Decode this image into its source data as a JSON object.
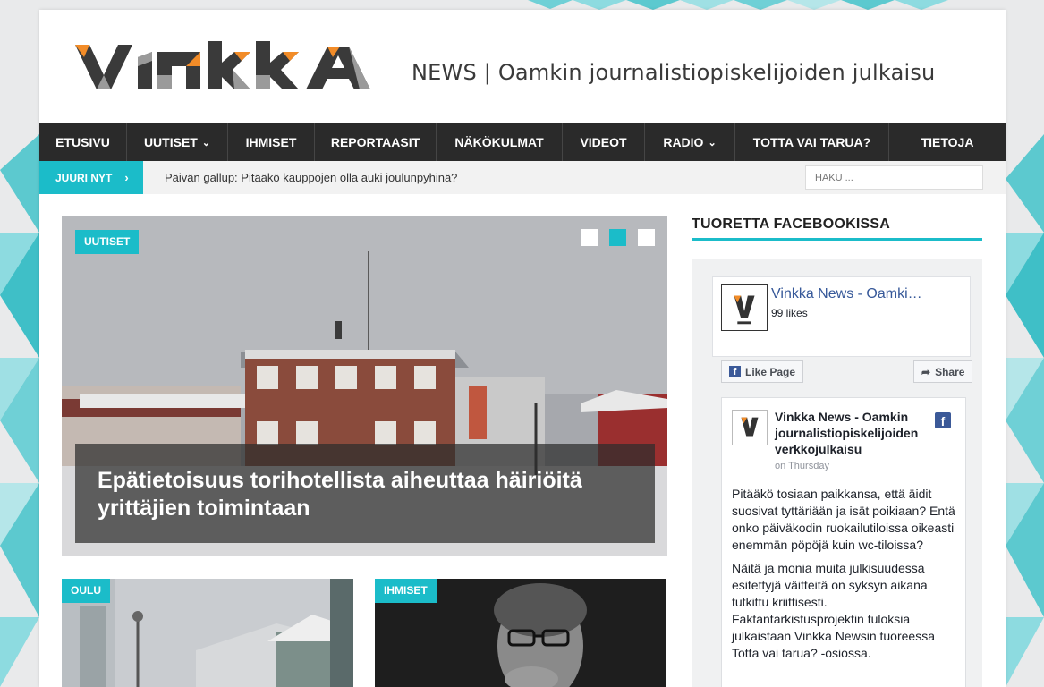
{
  "header": {
    "logo_text": "VINKKA",
    "tagline": "NEWS  | Oamkin journalistiopiskelijoiden julkaisu"
  },
  "nav": {
    "items": [
      {
        "label": "ETUSIVU",
        "dropdown": false
      },
      {
        "label": "UUTISET",
        "dropdown": true
      },
      {
        "label": "IHMISET",
        "dropdown": false
      },
      {
        "label": "REPORTAASIT",
        "dropdown": false
      },
      {
        "label": "NÄKÖKULMAT",
        "dropdown": false
      },
      {
        "label": "VIDEOT",
        "dropdown": false
      },
      {
        "label": "RADIO",
        "dropdown": true
      },
      {
        "label": "TOTTA VAI TARUA?",
        "dropdown": false
      },
      {
        "label": "TIETOJA",
        "dropdown": false
      }
    ],
    "chevron": "⌄"
  },
  "ticker": {
    "label": "JUURI NYT",
    "arrow": "›",
    "text": "Päivän gallup: Pitääkö kauppojen olla auki joulunpyhinä?"
  },
  "search": {
    "placeholder": "HAKU ..."
  },
  "featured": {
    "category": "UUTISET",
    "title": "Epätietoisuus torihotellista aiheuttaa häiriöitä yrittäjien toimintaan",
    "slides": 3,
    "active_slide": 2
  },
  "small_articles": [
    {
      "category": "OULU"
    },
    {
      "category": "IHMISET"
    }
  ],
  "sidebar": {
    "title": "TUORETTA FACEBOOKISSA",
    "facebook": {
      "page_name": "Vinkka News - Oamki…",
      "likes": "99 likes",
      "like_button": "Like Page",
      "share_button": "Share",
      "post": {
        "author": "Vinkka News - Oamkin journalistiopiskelijoiden verkkojulkaisu",
        "time": "on Thursday",
        "paragraphs": [
          "Pitääkö tosiaan paikkansa, että äidit suosivat tyttäriään ja isät poikiaan? Entä onko päiväkodin ruokailutiloissa oikeasti enemmän pöpöjä kuin wc-tiloissa?",
          "Näitä ja monia muita julkisuudessa esitettyjä väitteitä on syksyn aikana tutkittu kriittisesti. Faktantarkistusprojektin tuloksia julkaistaan Vinkka Newsin tuoreessa Totta vai tarua? -osiossa."
        ]
      }
    }
  },
  "colors": {
    "accent": "#1bbcc9",
    "nav_bg": "#2a2a2a",
    "logo_orange": "#f28c28",
    "facebook_blue": "#3b5998"
  }
}
